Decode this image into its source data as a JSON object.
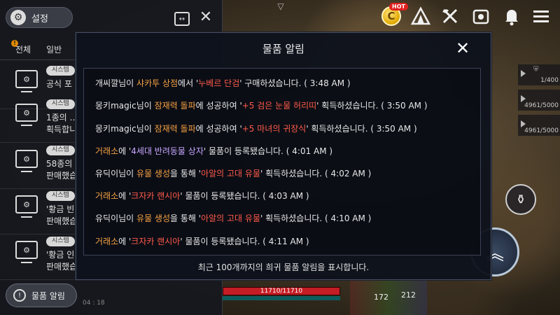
{
  "top_bar": {
    "hot_badge": "HOT",
    "coin_letter": "C",
    "icons": [
      "hot-coin-icon",
      "tent-icon",
      "axe-icon",
      "inventory-bag-icon",
      "bell-icon",
      "hamburger-menu-icon"
    ]
  },
  "hud": {
    "row1_value": "1/400",
    "row2_value": "4961/5000",
    "row3_value": "4961/5000",
    "hp_text": "11710/11710",
    "hp_fraction": 1.0,
    "stat_a": "172",
    "stat_b": "212"
  },
  "left_panel": {
    "settings_label": "설정",
    "tabs": [
      "전체",
      "일반"
    ],
    "messages": [
      {
        "tag": "시스템",
        "text": "공식 포"
      },
      {
        "tag": "시스템",
        "text": "1종의 …\n획득합니"
      },
      {
        "tag": "시스템",
        "text": "58종의\n판매했습"
      },
      {
        "tag": "시스템",
        "text": "'황금 빈\n판매했습"
      },
      {
        "tag": "시스템",
        "text": "'황금 인\n판매했습"
      }
    ],
    "notify_button": "물품 알림",
    "status_time": "04 : 18"
  },
  "modal": {
    "title": "물품 알림",
    "entries": [
      {
        "parts": [
          [
            "개씨깔",
            ""
          ],
          [
            "님이 ",
            ""
          ],
          [
            "샤카투 상점",
            "orange"
          ],
          [
            "에서 '",
            ""
          ],
          [
            "누베르 단검",
            "red"
          ],
          [
            "' 구매하셨습니다. ( 3:48 AM )",
            ""
          ]
        ]
      },
      {
        "parts": [
          [
            "몽키magic",
            ""
          ],
          [
            "님이 ",
            ""
          ],
          [
            "잠재력 돌파",
            "orange"
          ],
          [
            "에 성공하여 '",
            ""
          ],
          [
            "+5 검은 눈물 허리띠",
            "red"
          ],
          [
            "' 획득하셨습니다. ( 3:50 AM )",
            ""
          ]
        ]
      },
      {
        "parts": [
          [
            "몽키magic",
            ""
          ],
          [
            "님이 ",
            ""
          ],
          [
            "잠재력 돌파",
            "orange"
          ],
          [
            "에 성공하여 '",
            ""
          ],
          [
            "+5 마녀의 귀장식",
            "red"
          ],
          [
            "' 획득하셨습니다. ( 3:50 AM )",
            ""
          ]
        ]
      },
      {
        "parts": [
          [
            "거래소",
            "orange"
          ],
          [
            "에 '",
            ""
          ],
          [
            "4세대 반려동물 상자",
            "blue"
          ],
          [
            "' 물품이 등록됐습니다. ( 4:01 AM )",
            ""
          ]
        ]
      },
      {
        "parts": [
          [
            "유딕이",
            ""
          ],
          [
            "님이 ",
            ""
          ],
          [
            "유물 생성",
            "orange"
          ],
          [
            "을 통해 '",
            ""
          ],
          [
            "아알의 고대 유물",
            "red"
          ],
          [
            "' 획득하셨습니다. ( 4:02 AM )",
            ""
          ]
        ]
      },
      {
        "parts": [
          [
            "거래소",
            "orange"
          ],
          [
            "에 '",
            ""
          ],
          [
            "크자카 랜시아",
            "red"
          ],
          [
            "' 물품이 등록됐습니다. ( 4:03 AM )",
            ""
          ]
        ]
      },
      {
        "parts": [
          [
            "유딕이",
            ""
          ],
          [
            "님이 ",
            ""
          ],
          [
            "유물 생성",
            "orange"
          ],
          [
            "을 통해 '",
            ""
          ],
          [
            "아알의 고대 유물",
            "red"
          ],
          [
            "' 획득하셨습니다. ( 4:10 AM )",
            ""
          ]
        ]
      },
      {
        "parts": [
          [
            "거래소",
            "orange"
          ],
          [
            "에 '",
            ""
          ],
          [
            "크자카 랜시아",
            "red"
          ],
          [
            "' 물품이 등록됐습니다. ( 4:11 AM )",
            ""
          ]
        ]
      }
    ],
    "footer": "최근 100개까지의 희귀 물품 알림을 표시합니다.",
    "colors": {
      "orange": "#f5a142",
      "red": "#ff5a4a",
      "blue": "#c8a8ff"
    }
  }
}
